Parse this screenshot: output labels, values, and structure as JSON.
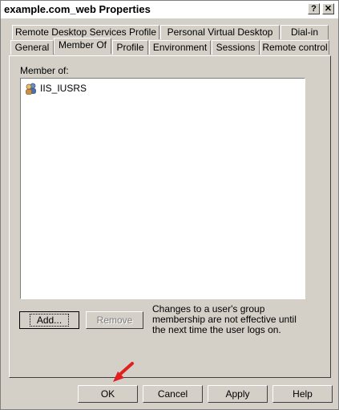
{
  "window": {
    "title": "example.com_web Properties"
  },
  "titlebar_buttons": {
    "help": "?",
    "close": "✕"
  },
  "tabs_back": [
    "Remote Desktop Services Profile",
    "Personal Virtual Desktop",
    "Dial-in"
  ],
  "tabs_front": [
    "General",
    "Member Of",
    "Profile",
    "Environment",
    "Sessions",
    "Remote control"
  ],
  "active_tab": "Member Of",
  "member_of": {
    "label": "Member of:",
    "items": [
      "IIS_IUSRS"
    ]
  },
  "buttons": {
    "add": "Add...",
    "remove": "Remove",
    "ok": "OK",
    "cancel": "Cancel",
    "apply": "Apply",
    "help": "Help"
  },
  "note": "Changes to a user's group membership are not effective until the next time the user logs on.",
  "colors": {
    "annotation_arrow": "#e02020"
  }
}
